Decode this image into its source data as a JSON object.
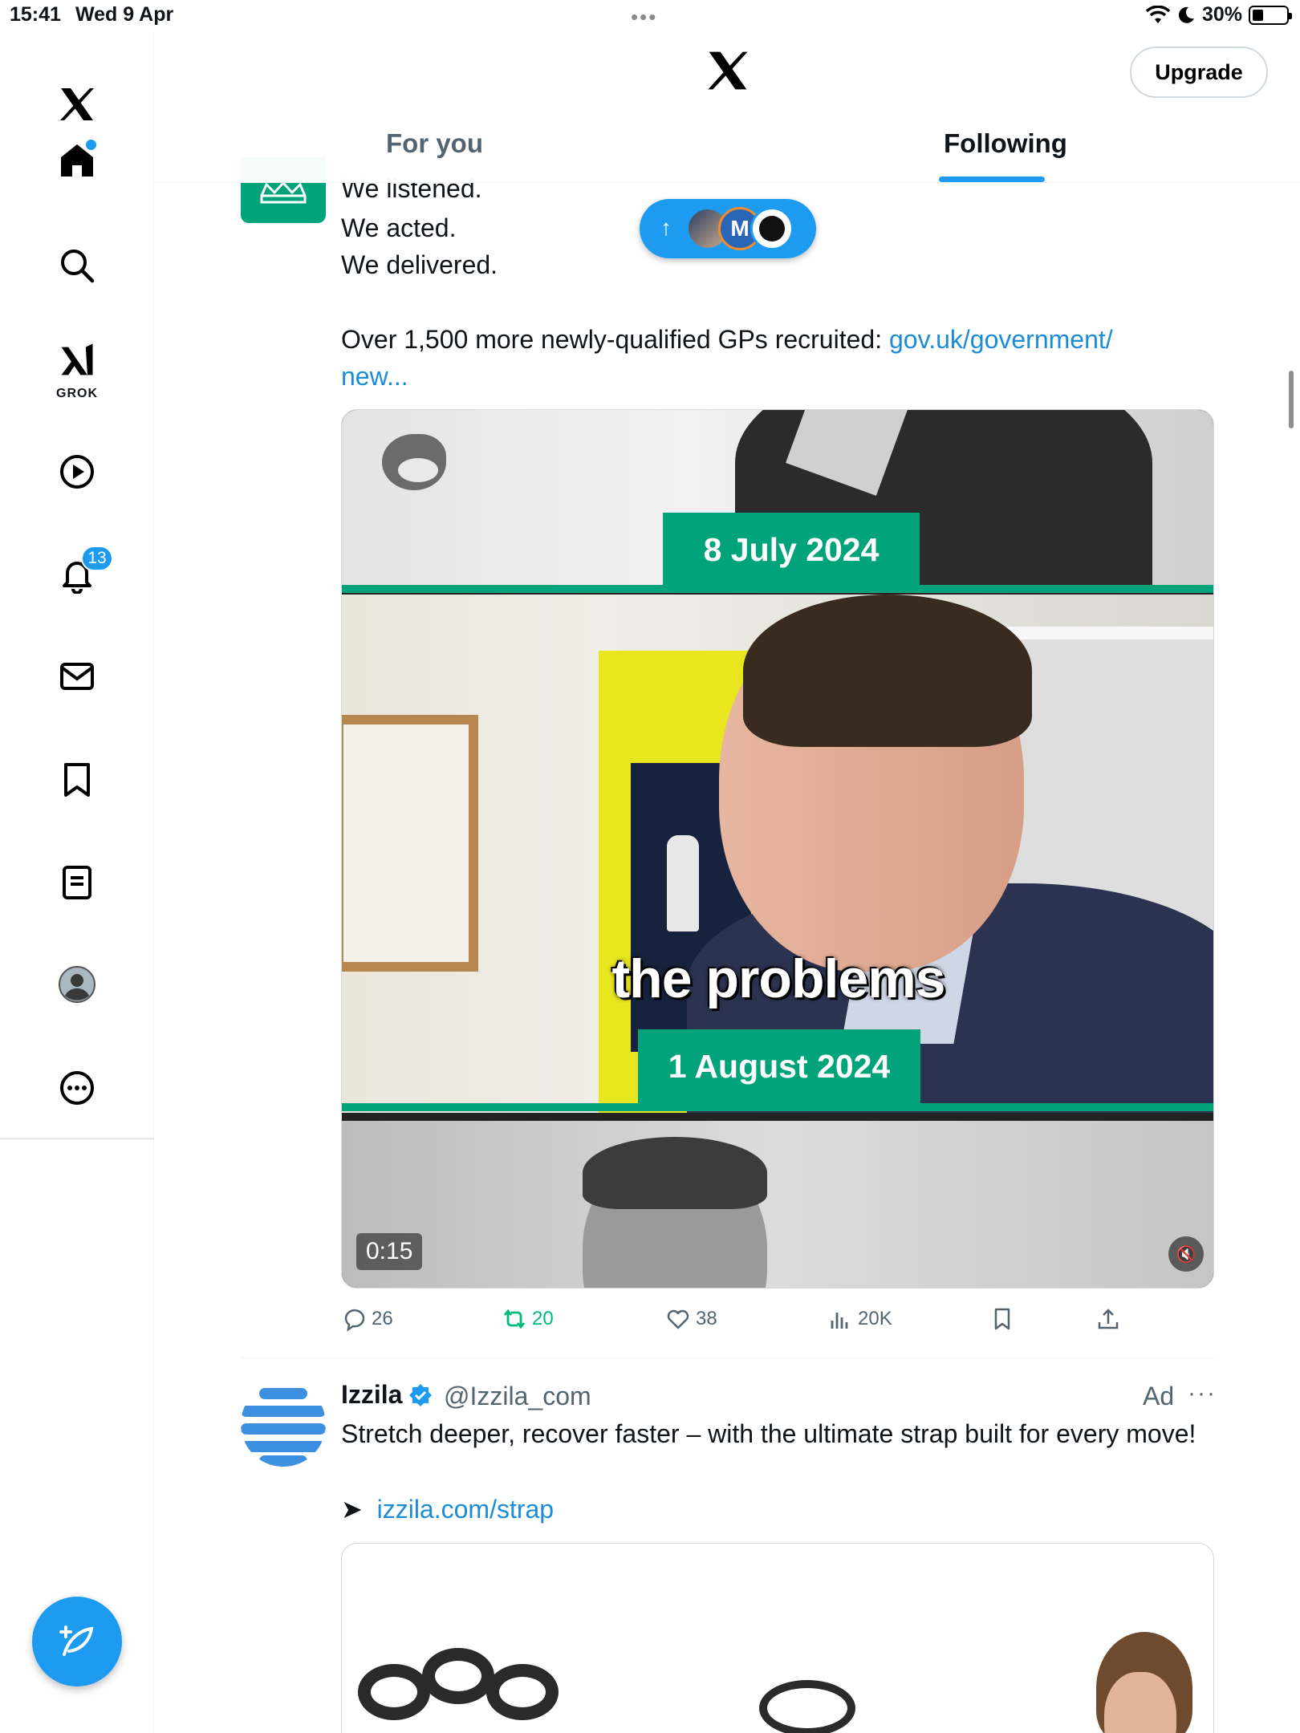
{
  "status_bar": {
    "time": "15:41",
    "date": "Wed 9 Apr",
    "battery": "30%"
  },
  "sidebar": {
    "items": [
      {
        "name": "home",
        "icon": "home-icon"
      },
      {
        "name": "search",
        "icon": "search-icon"
      },
      {
        "name": "grok",
        "icon": "grok-icon",
        "label": "GROK"
      },
      {
        "name": "video",
        "icon": "play-icon"
      },
      {
        "name": "notifications",
        "icon": "bell-icon",
        "badge": "13"
      },
      {
        "name": "messages",
        "icon": "mail-icon"
      },
      {
        "name": "bookmarks",
        "icon": "bookmark-icon"
      },
      {
        "name": "lists",
        "icon": "list-icon"
      },
      {
        "name": "profile",
        "icon": "avatar-icon"
      },
      {
        "name": "more",
        "icon": "more-icon"
      }
    ],
    "compose_icon": "compose-feather-icon"
  },
  "header": {
    "logo": "x-logo-icon",
    "upgrade_label": "Upgrade",
    "tabs": [
      {
        "label": "For you",
        "active": false
      },
      {
        "label": "Following",
        "active": true
      }
    ]
  },
  "colors": {
    "accent": "#1d9bf0",
    "gov_green": "#00a37a",
    "retweet_green": "#00ba7c",
    "muted_text": "#536471"
  },
  "tweet": {
    "lines": [
      "We listened.",
      "We acted.",
      "We delivered."
    ],
    "body": "Over 1,500 more newly-qualified GPs recruited: ",
    "link_line1": "gov.uk/government/",
    "link_line2": "new...",
    "media": {
      "date_top": "8 July 2024",
      "caption": "the problems",
      "date_bottom": "1 August 2024",
      "duration": "0:15"
    },
    "actions": {
      "replies": "26",
      "retweets": "20",
      "likes": "38",
      "views": "20K"
    }
  },
  "ad": {
    "name": "Izzila",
    "handle": "@Izzila_com",
    "label": "Ad",
    "text": "Stretch deeper, recover faster – with the ultimate strap built for every move!",
    "arrow": "➤",
    "link": "izzila.com/strap"
  }
}
